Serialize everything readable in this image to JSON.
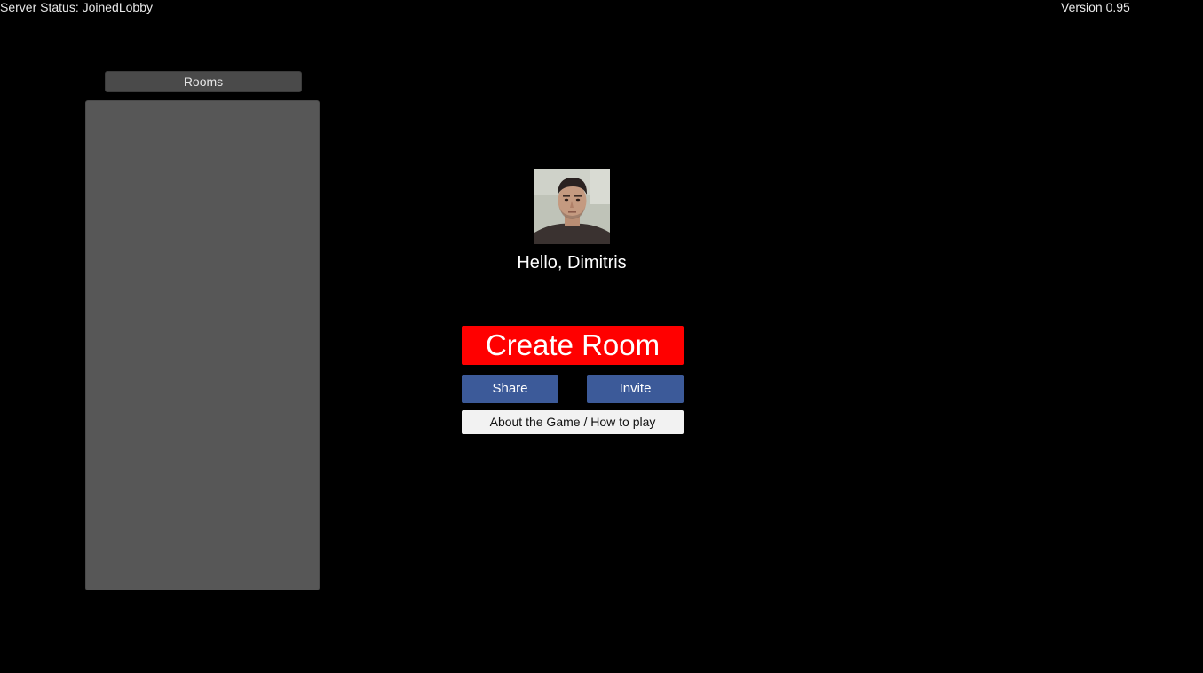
{
  "status_bar": {
    "server_status": "Server Status: JoinedLobby",
    "version": "Version 0.95"
  },
  "rooms": {
    "header_label": "Rooms",
    "items": []
  },
  "profile": {
    "greeting": "Hello, Dimitris"
  },
  "actions": {
    "create_room_label": "Create Room",
    "share_label": "Share",
    "invite_label": "Invite",
    "about_label": "About the Game / How to play"
  },
  "colors": {
    "background": "#000000",
    "create_room": "#ff0000",
    "facebook_blue": "#3c5a99",
    "rooms_panel": "#575757",
    "about_button": "#f2f2f2"
  }
}
